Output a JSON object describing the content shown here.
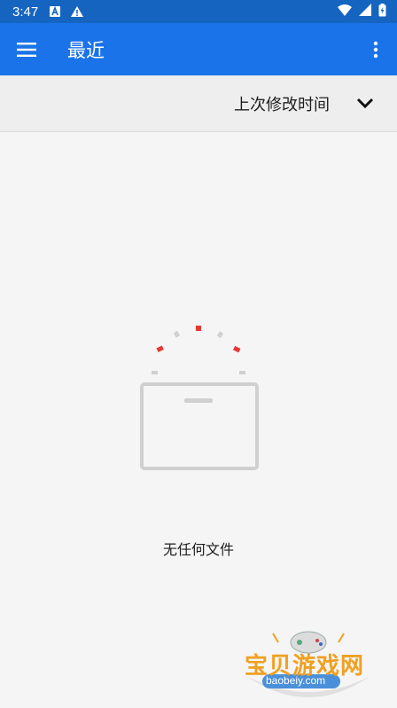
{
  "status_bar": {
    "time": "3:47",
    "icons": [
      "a-icon",
      "warning-icon",
      "wifi-icon",
      "signal-icon",
      "battery-icon"
    ]
  },
  "app_bar": {
    "title": "最近",
    "menu_icon": "hamburger-icon",
    "more_icon": "more-vertical-icon",
    "background": "#1a73e8"
  },
  "sort_bar": {
    "label": "上次修改时间",
    "icon": "chevron-down-icon"
  },
  "empty_state": {
    "message": "无任何文件",
    "icon": "empty-box-icon",
    "accent": "#e53935"
  },
  "watermark": {
    "title": "宝贝游戏网",
    "url": "baobeiy.com"
  }
}
